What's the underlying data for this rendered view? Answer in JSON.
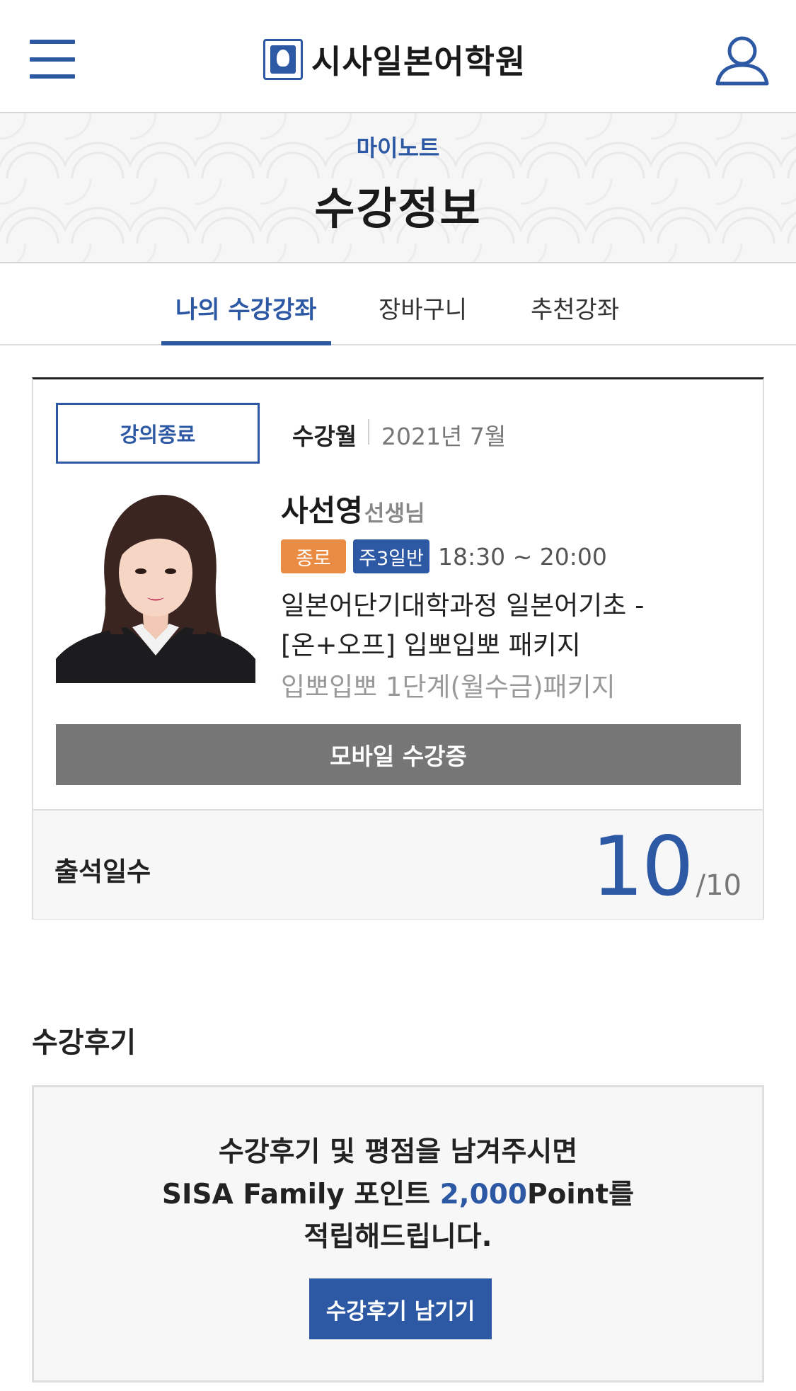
{
  "header": {
    "logo_text": "시사일본어학원",
    "menu_icon": "hamburger-menu-icon",
    "user_icon": "user-profile-icon",
    "accent_color": "#2c58a4"
  },
  "hero": {
    "subtitle": "마이노트",
    "title": "수강정보"
  },
  "tabs": [
    {
      "label": "나의 수강강좌",
      "active": true
    },
    {
      "label": "장바구니",
      "active": false
    },
    {
      "label": "추천강좌",
      "active": false
    }
  ],
  "course": {
    "status": "강의종료",
    "month_label": "수강월",
    "month_value": "2021년 7월",
    "teacher_name": "사선영",
    "teacher_suffix": "선생님",
    "tags": [
      {
        "label": "종로",
        "color": "#e98b43"
      },
      {
        "label": "주3일반",
        "color": "#2c58a4"
      }
    ],
    "time": "18:30 ~ 20:00",
    "title_line1": "일본어단기대학과정 일본어기초 -",
    "title_line2": "[온+오프] 입뽀입뽀 패키지",
    "subtitle": "입뽀입뽀 1단계(월수금)패키지",
    "mobile_button": "모바일 수강증",
    "attendance_label": "출석일수",
    "attendance_count": "10",
    "attendance_total": "/10"
  },
  "review": {
    "heading": "수강후기",
    "line1": "수강후기 및 평점을 남겨주시면",
    "line2_pre": "SISA Family 포인트 ",
    "line2_points": "2,000",
    "line2_post": "Point를",
    "line3": "적립해드립니다.",
    "button": "수강후기 남기기"
  }
}
